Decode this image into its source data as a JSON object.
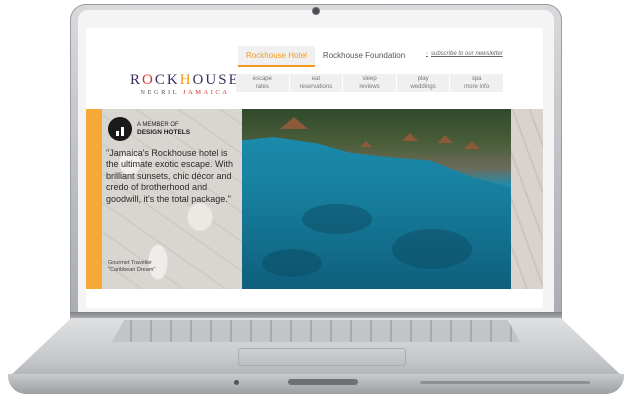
{
  "website": {
    "tabs": [
      {
        "label": "Rockhouse Hotel",
        "active": true
      },
      {
        "label": "Rockhouse Foundation",
        "active": false
      }
    ],
    "subscribe_link": "subscribe to our newsletter",
    "logo": {
      "main_prefix": "R",
      "main_o": "O",
      "main_mid": "CK",
      "main_h": "H",
      "main_suffix": "O",
      "main_end": "USE",
      "sub_negril": "NEGRIL",
      "sub_jamaica": "JAMAICA"
    },
    "nav": [
      {
        "top": "escape",
        "bottom": "rates"
      },
      {
        "top": "eat",
        "bottom": "reservations"
      },
      {
        "top": "sleep",
        "bottom": "reviews"
      },
      {
        "top": "play",
        "bottom": "weddings"
      },
      {
        "top": "spa",
        "bottom": "more info"
      }
    ],
    "badge": {
      "line1": "A MEMBER OF",
      "line2": "DESIGN HOTELS"
    },
    "quote": "\"Jamaica's Rockhouse hotel is the ultimate exotic escape. With brilliant sunsets, chic décor and credo of brotherhood and goodwill, it's the total package.\"",
    "source": {
      "line1": "Gourmet Traveller",
      "line2": "\"Caribbean Dream\""
    }
  },
  "colors": {
    "accent": "#f39a1e",
    "sidebar": "#f7a938",
    "logo_purple": "#3b2f5e",
    "logo_red": "#d62e2e"
  },
  "icons": {
    "badge": "design-hotels-logo-icon",
    "subscribe": "arrow-right-icon"
  }
}
